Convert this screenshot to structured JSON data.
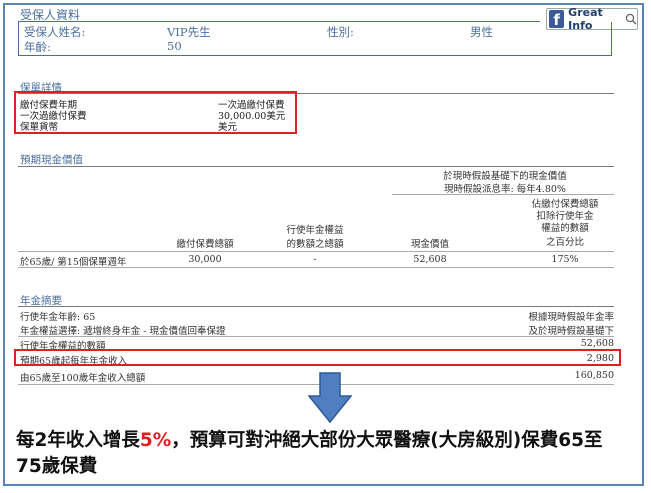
{
  "badge": {
    "label": "Great Info"
  },
  "insured": {
    "header": "受保人資料",
    "name_label": "受保人姓名:",
    "name_value": "VIP先生",
    "gender_label": "性別:",
    "gender_value": "男性",
    "age_label": "年齡:",
    "age_value": "50"
  },
  "policy": {
    "header": "保單詳情",
    "rows": [
      {
        "label": "繳付保費年期",
        "value": "一次過繳付保費"
      },
      {
        "label": "一次過繳付保費",
        "value": "30,000.00美元"
      },
      {
        "label": "保單貨幣",
        "value": "美元"
      }
    ]
  },
  "cash_value": {
    "header": "預期現金價值",
    "basis_line1": "於現時假設基礎下的現金價值",
    "basis_line2": "現時假設派息率: 每年4.80%",
    "col1": "繳付保費總額",
    "col2_line1": "行使年金權益",
    "col2_line2": "的數額之總額",
    "col3": "現金價值",
    "col4_line1": "佔繳付保費總額",
    "col4_line2": "扣除行使年金",
    "col4_line3": "權益的數額",
    "col4_line4": "之百分比",
    "row": {
      "label": "於65歲/ 第15個保單週年",
      "premium": "30,000",
      "annuity": "-",
      "cash": "52,608",
      "percent": "175%"
    }
  },
  "annuity": {
    "header": "年金摘要",
    "age_label": "行使年金年齡: 65",
    "option_label": "年金權益選擇: 遞增終身年金 - 現金價值回奉保證",
    "right_line1": "根據現時假設年金率",
    "right_line2": "及於現時假設基礎下",
    "amount_label": "行使年金權益的數額",
    "amount_value": "52,608",
    "first_year_label": "預期65歲起每年年金收入",
    "first_year_value": "2,980",
    "total_label": "由65歲至100歲年金收入總額",
    "total_value": "160,850"
  },
  "caption": {
    "part1": "每2年收入增長",
    "highlight": "5%",
    "part2": "，預算可對沖絕大部份大眾醫療(大房級別)保費65至75歲保費"
  }
}
